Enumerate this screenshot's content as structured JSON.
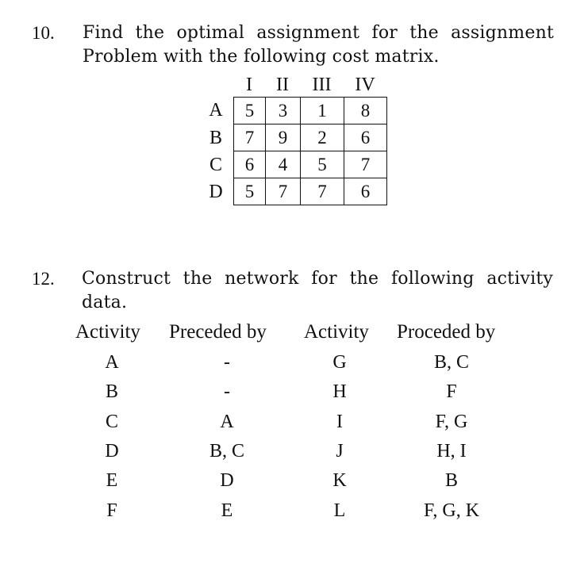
{
  "questions": [
    {
      "number": "10.",
      "lines": [
        "Find the optimal assignment for the assignment",
        "Problem with the following cost matrix."
      ],
      "cost_matrix": {
        "column_headers": [
          "I",
          "II",
          "III",
          "IV"
        ],
        "row_headers": [
          "A",
          "B",
          "C",
          "D"
        ],
        "rows": [
          [
            "5",
            "3",
            "1",
            "8"
          ],
          [
            "7",
            "9",
            "2",
            "6"
          ],
          [
            "6",
            "4",
            "5",
            "7"
          ],
          [
            "5",
            "7",
            "7",
            "6"
          ]
        ]
      }
    },
    {
      "number": "12.",
      "lines": [
        "Construct the network for the following activity",
        "data."
      ],
      "activity_table": {
        "headers": [
          "Activity",
          "Preceded by",
          "Activity",
          "Proceded by"
        ],
        "rows": [
          [
            "A",
            "-",
            "G",
            "B, C"
          ],
          [
            "B",
            "-",
            "H",
            "F"
          ],
          [
            "C",
            "A",
            "I",
            "F, G"
          ],
          [
            "D",
            "B, C",
            "J",
            "H, I"
          ],
          [
            "E",
            "D",
            "K",
            "B"
          ],
          [
            "F",
            "E",
            "L",
            "F, G, K"
          ]
        ]
      }
    }
  ]
}
